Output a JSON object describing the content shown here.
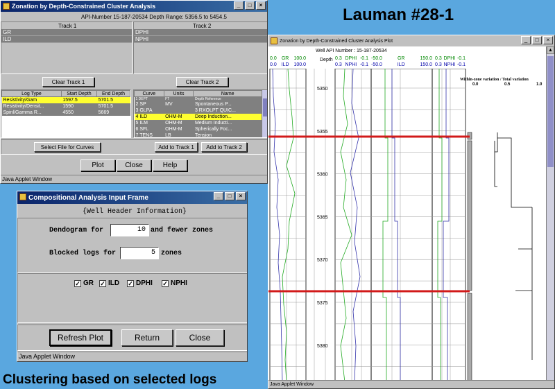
{
  "heading_right": "Lauman #28-1",
  "caption_bottom": "Clustering based on selected logs",
  "win1": {
    "title": "Zonation by Depth-Constrained Cluster Analysis",
    "header": "API-Number  15-187-20534  Depth Range: 5356.5 to 5454.5",
    "track1_label": "Track 1",
    "track2_label": "Track 2",
    "track1_items": [
      "GR",
      "ILD"
    ],
    "track2_items": [
      "DPHI",
      "NPHI"
    ],
    "clear_track1": "Clear Track 1",
    "clear_track2": "Clear Track 2",
    "logtable": {
      "headers": [
        "Log Type",
        "Start Depth",
        "End Depth"
      ],
      "rows": [
        [
          "Resistivity/Gam",
          "1597.5",
          "5701.5"
        ],
        [
          "Resistivity/Densit...",
          "1590",
          "5701.5"
        ],
        [
          "Spinl/Gamma R...",
          "4550",
          "5669"
        ]
      ]
    },
    "curvetable": {
      "headers": [
        "Curve",
        "Units",
        "Name"
      ],
      "rows": [
        [
          "1 DEPT",
          "FT",
          "Depth Reference"
        ],
        [
          "2 SP",
          "MV",
          "Spontaneous P..."
        ],
        [
          "3 GLPA",
          "",
          "3 RXOLPT QUIC..."
        ],
        [
          "4 ILD",
          "OHM-M",
          "Deep Induction..."
        ],
        [
          "5 ILM",
          "OHM-M",
          "Medium Inducti..."
        ],
        [
          "6 SFL",
          "OHM-M",
          "Spherically Foc..."
        ],
        [
          "7 TENS",
          "LB",
          "Tension"
        ]
      ]
    },
    "select_file": "Select File for Curves",
    "add_track1": "Add to Track 1",
    "add_track2": "Add to Track 2",
    "plot": "Plot",
    "close": "Close",
    "help": "Help",
    "status": "Java Applet Window"
  },
  "win2": {
    "title": "Compositional Analysis Input Frame",
    "header": "{Well Header Information}",
    "dendogram_label": "Dendogram for",
    "dendogram_value": "10",
    "dendogram_suffix": "and fewer zones",
    "blocked_label": "Blocked logs for",
    "blocked_value": "5",
    "blocked_suffix": "zones",
    "checkboxes": [
      "GR",
      "ILD",
      "DPHI",
      "NPHI"
    ],
    "refresh": "Refresh Plot",
    "return": "Return",
    "close": "Close",
    "status": "Java Applet Window"
  },
  "win3": {
    "title": "Zonation by Depth-Constrained Cluster Analysis Plot",
    "api": "Well API Number : 15-187-20534",
    "depth_label": "Depth",
    "track1_head": {
      "top": [
        "0.0",
        "GR",
        "100.0"
      ],
      "bottom": [
        "0.0",
        "ILD",
        "100.0"
      ]
    },
    "track2_head": {
      "top": [
        "0.3",
        "DPHI",
        "-0.1"
      ],
      "bottom": [
        "0.3",
        "NPHI",
        "-0.1"
      ]
    },
    "track3_head": {
      "top": [
        "-50.0",
        "GR",
        "150.0"
      ],
      "bottom": [
        "-50.0",
        "ILD",
        "150.0"
      ]
    },
    "track4_head": {
      "top": [
        "0.3",
        "DPHI",
        "-0.1"
      ],
      "bottom": [
        "0.3",
        "NPHI",
        "-0.1"
      ]
    },
    "depths": [
      "5350",
      "5355",
      "5360",
      "5365",
      "5370",
      "5375",
      "5380"
    ],
    "variation_label": "Within-zone variation / Total variation",
    "variation_ticks": [
      "0.0",
      "0.5",
      "1.0"
    ],
    "status": "Java Applet Window"
  }
}
